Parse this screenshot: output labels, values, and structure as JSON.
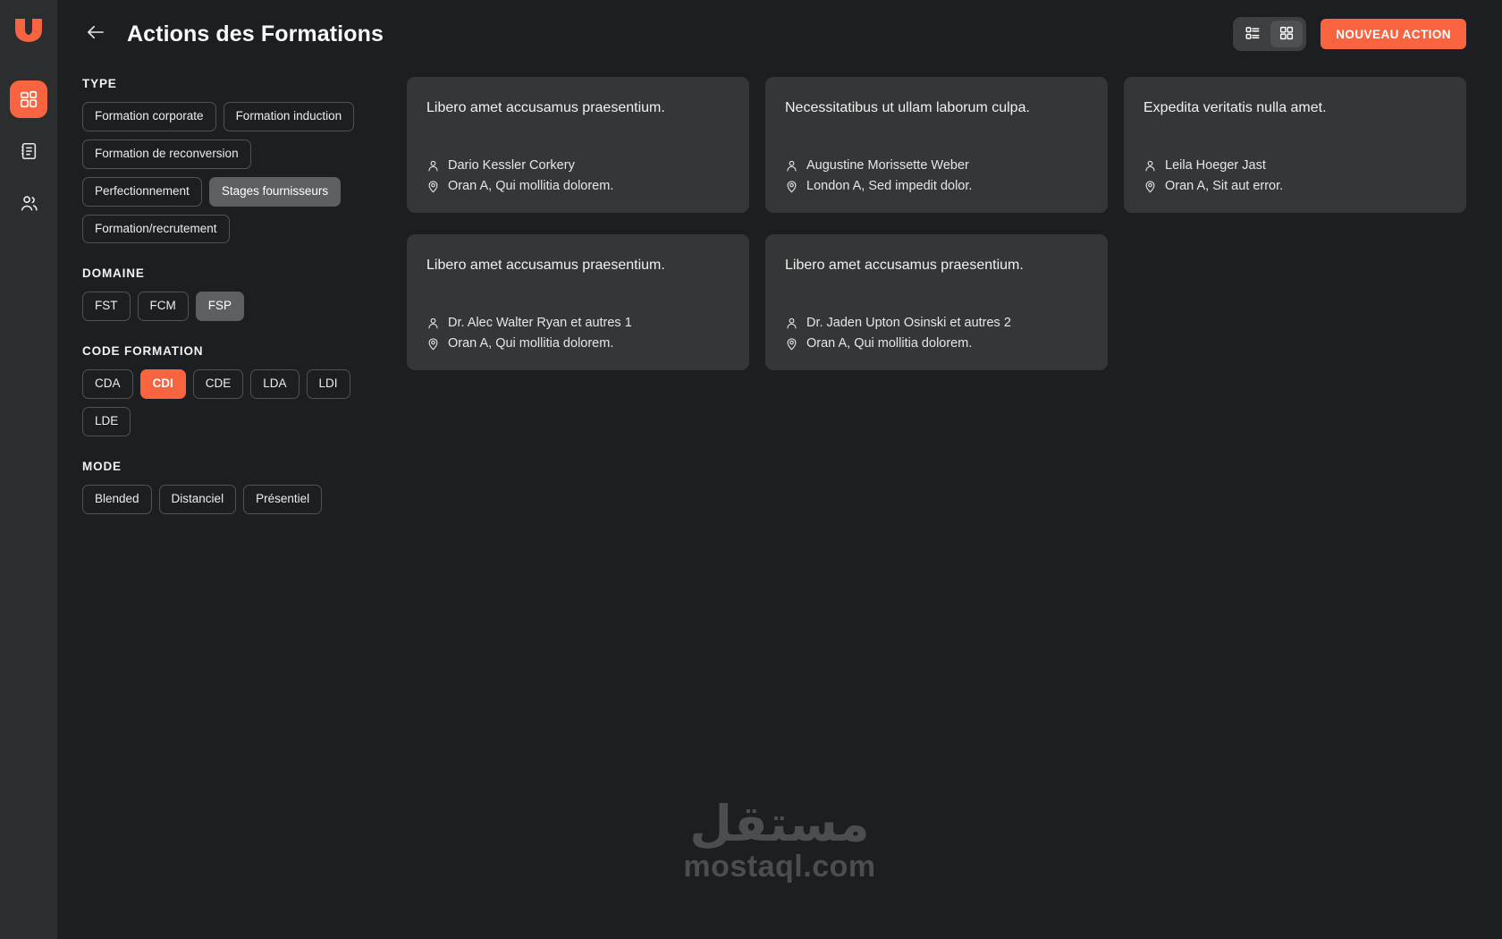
{
  "theme": {
    "accent": "#f8643f",
    "page_bg": "#1c1e21",
    "sidebar_bg": "#2b2d2f",
    "card_bg": "#343638",
    "chip_border": "#505254",
    "chip_hover_bg": "#5d5f61",
    "text": "#e8e8e8"
  },
  "sidebar": {
    "logo": "app-logo",
    "items": [
      {
        "icon": "dashboard-grid-icon",
        "name": "sidebar-item-dashboard",
        "active": true
      },
      {
        "icon": "notebook-icon",
        "name": "sidebar-item-catalog",
        "active": false
      },
      {
        "icon": "users-icon",
        "name": "sidebar-item-users",
        "active": false
      }
    ]
  },
  "header": {
    "back_icon": "arrow-left-icon",
    "title": "Actions des Formations",
    "view_toggle": {
      "options": [
        {
          "id": "list",
          "icon": "list-view-icon",
          "label": "Liste",
          "active": false
        },
        {
          "id": "grid",
          "icon": "grid-view-icon",
          "label": "Grille",
          "active": true
        }
      ]
    },
    "new_action_label": "NOUVEAU ACTION"
  },
  "filters": [
    {
      "legend": "TYPE",
      "name": "filter-group-type",
      "chips": [
        {
          "label": "Formation corporate",
          "state": "default"
        },
        {
          "label": "Formation induction",
          "state": "default"
        },
        {
          "label": "Formation de reconversion",
          "state": "default"
        },
        {
          "label": "Perfectionnement",
          "state": "default"
        },
        {
          "label": "Stages fournisseurs",
          "state": "hovered"
        },
        {
          "label": "Formation/recrutement",
          "state": "default"
        }
      ]
    },
    {
      "legend": "DOMAINE",
      "name": "filter-group-domaine",
      "chips": [
        {
          "label": "FST",
          "state": "default"
        },
        {
          "label": "FCM",
          "state": "default"
        },
        {
          "label": "FSP",
          "state": "hovered"
        }
      ]
    },
    {
      "legend": "CODE FORMATION",
      "name": "filter-group-code-formation",
      "chips": [
        {
          "label": "CDA",
          "state": "default"
        },
        {
          "label": "CDI",
          "state": "selected"
        },
        {
          "label": "CDE",
          "state": "default"
        },
        {
          "label": "LDA",
          "state": "default"
        },
        {
          "label": "LDI",
          "state": "default"
        },
        {
          "label": "LDE",
          "state": "default"
        }
      ]
    },
    {
      "legend": "MODE",
      "name": "filter-group-mode",
      "chips": [
        {
          "label": "Blended",
          "state": "default"
        },
        {
          "label": "Distanciel",
          "state": "default"
        },
        {
          "label": "Présentiel",
          "state": "default"
        }
      ]
    }
  ],
  "cards": [
    {
      "title": "Libero amet accusamus praesentium.",
      "person": "Dario Kessler Corkery",
      "location": "Oran A, Qui mollitia dolorem."
    },
    {
      "title": "Necessitatibus ut ullam laborum culpa.",
      "person": "Augustine Morissette Weber",
      "location": "London A, Sed impedit dolor."
    },
    {
      "title": "Expedita veritatis nulla amet.",
      "person": "Leila Hoeger Jast",
      "location": "Oran A, Sit aut error."
    },
    {
      "title": "Libero amet accusamus praesentium.",
      "person": "Dr. Alec Walter Ryan et autres 1",
      "location": "Oran A, Qui mollitia dolorem."
    },
    {
      "title": "Libero amet accusamus praesentium.",
      "person": "Dr. Jaden Upton Osinski et autres 2",
      "location": "Oran A, Qui mollitia dolorem."
    }
  ],
  "watermark": {
    "arabic": "مستقل",
    "latin": "mostaql.com"
  }
}
